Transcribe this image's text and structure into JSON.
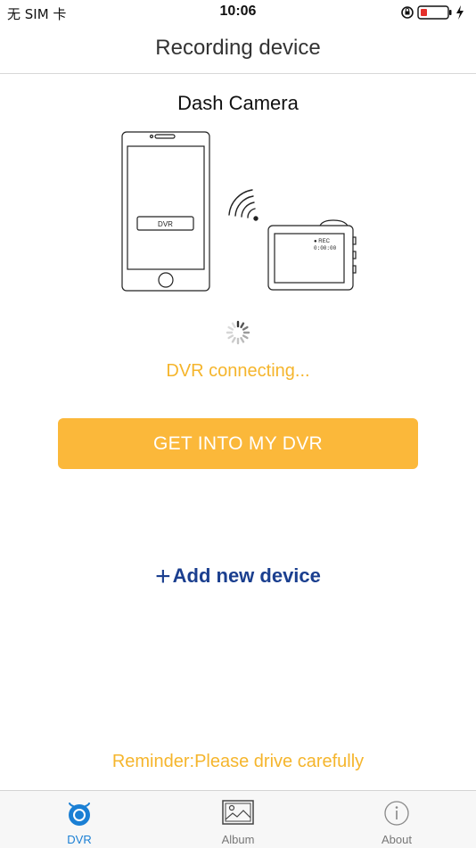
{
  "status_bar": {
    "carrier": "无 SIM 卡",
    "time": "10:06"
  },
  "nav": {
    "title": "Recording device"
  },
  "device": {
    "name": "Dash Camera",
    "phone_screen_label": "DVR",
    "camera_rec_label": "● REC",
    "camera_timecode": "0:00:00"
  },
  "connection": {
    "status": "DVR connecting..."
  },
  "actions": {
    "primary_label": "GET INTO MY DVR",
    "add_device_plus": "+",
    "add_device_label": "Add new device"
  },
  "reminder": "Reminder:Please drive carefully",
  "tabs": [
    {
      "label": "DVR",
      "icon": "dvr-icon",
      "active": true
    },
    {
      "label": "Album",
      "icon": "album-icon",
      "active": false
    },
    {
      "label": "About",
      "icon": "about-icon",
      "active": false
    }
  ],
  "colors": {
    "accent_orange": "#fbb83a",
    "status_orange": "#f5b52c",
    "link_blue": "#1b3f8f",
    "tab_active_blue": "#1a7fd4"
  }
}
